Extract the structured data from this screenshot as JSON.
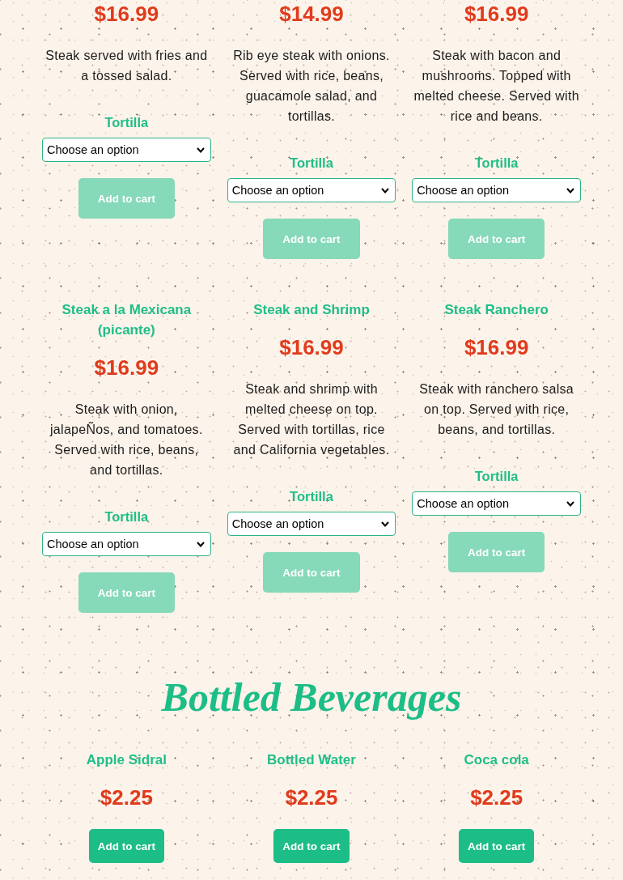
{
  "sections": [
    {
      "items": [
        {
          "price": "$16.99",
          "description": "Steak served with fries and a tossed salad.",
          "option": {
            "label": "Tortilla",
            "value": "Choose an option"
          },
          "button": {
            "label": "Add to cart",
            "disabled": true
          }
        },
        {
          "price": "$14.99",
          "description": "Rib eye steak with onions. Served with rice, beans, guacamole salad, and tortillas.",
          "option": {
            "label": "Tortilla",
            "value": "Choose an option"
          },
          "button": {
            "label": "Add to cart",
            "disabled": true
          }
        },
        {
          "price": "$16.99",
          "description": "Steak with bacon and mushrooms. Topped with melted cheese. Served with rice and beans.",
          "option": {
            "label": "Tortilla",
            "value": "Choose an option"
          },
          "button": {
            "label": "Add to cart",
            "disabled": true
          }
        },
        {
          "name": "Steak a la Mexicana (picante)",
          "price": "$16.99",
          "description": "Steak with onion, jalapeÑos, and tomatoes. Served with rice, beans, and tortillas.",
          "option": {
            "label": "Tortilla",
            "value": "Choose an option"
          },
          "button": {
            "label": "Add to cart",
            "disabled": true
          }
        },
        {
          "name": "Steak and Shrimp",
          "price": "$16.99",
          "description": "Steak and shrimp with melted cheese on top. Served with tortillas, rice and California vegetables.",
          "option": {
            "label": "Tortilla",
            "value": "Choose an option"
          },
          "button": {
            "label": "Add to cart",
            "disabled": true
          }
        },
        {
          "name": "Steak Ranchero",
          "price": "$16.99",
          "description": "Steak with ranchero salsa on top. Served with rice, beans, and tortillas.",
          "option": {
            "label": "Tortilla",
            "value": "Choose an option"
          },
          "button": {
            "label": "Add to cart",
            "disabled": true
          }
        }
      ]
    },
    {
      "title": "Bottled Beverages",
      "items": [
        {
          "name": "Apple Sidral",
          "price": "$2.25",
          "button": {
            "label": "Add to cart",
            "disabled": false
          }
        },
        {
          "name": "Bottled Water",
          "price": "$2.25",
          "button": {
            "label": "Add to cart",
            "disabled": false
          }
        },
        {
          "name": "Coca cola",
          "price": "$2.25",
          "button": {
            "label": "Add to cart",
            "disabled": false
          }
        }
      ]
    }
  ]
}
